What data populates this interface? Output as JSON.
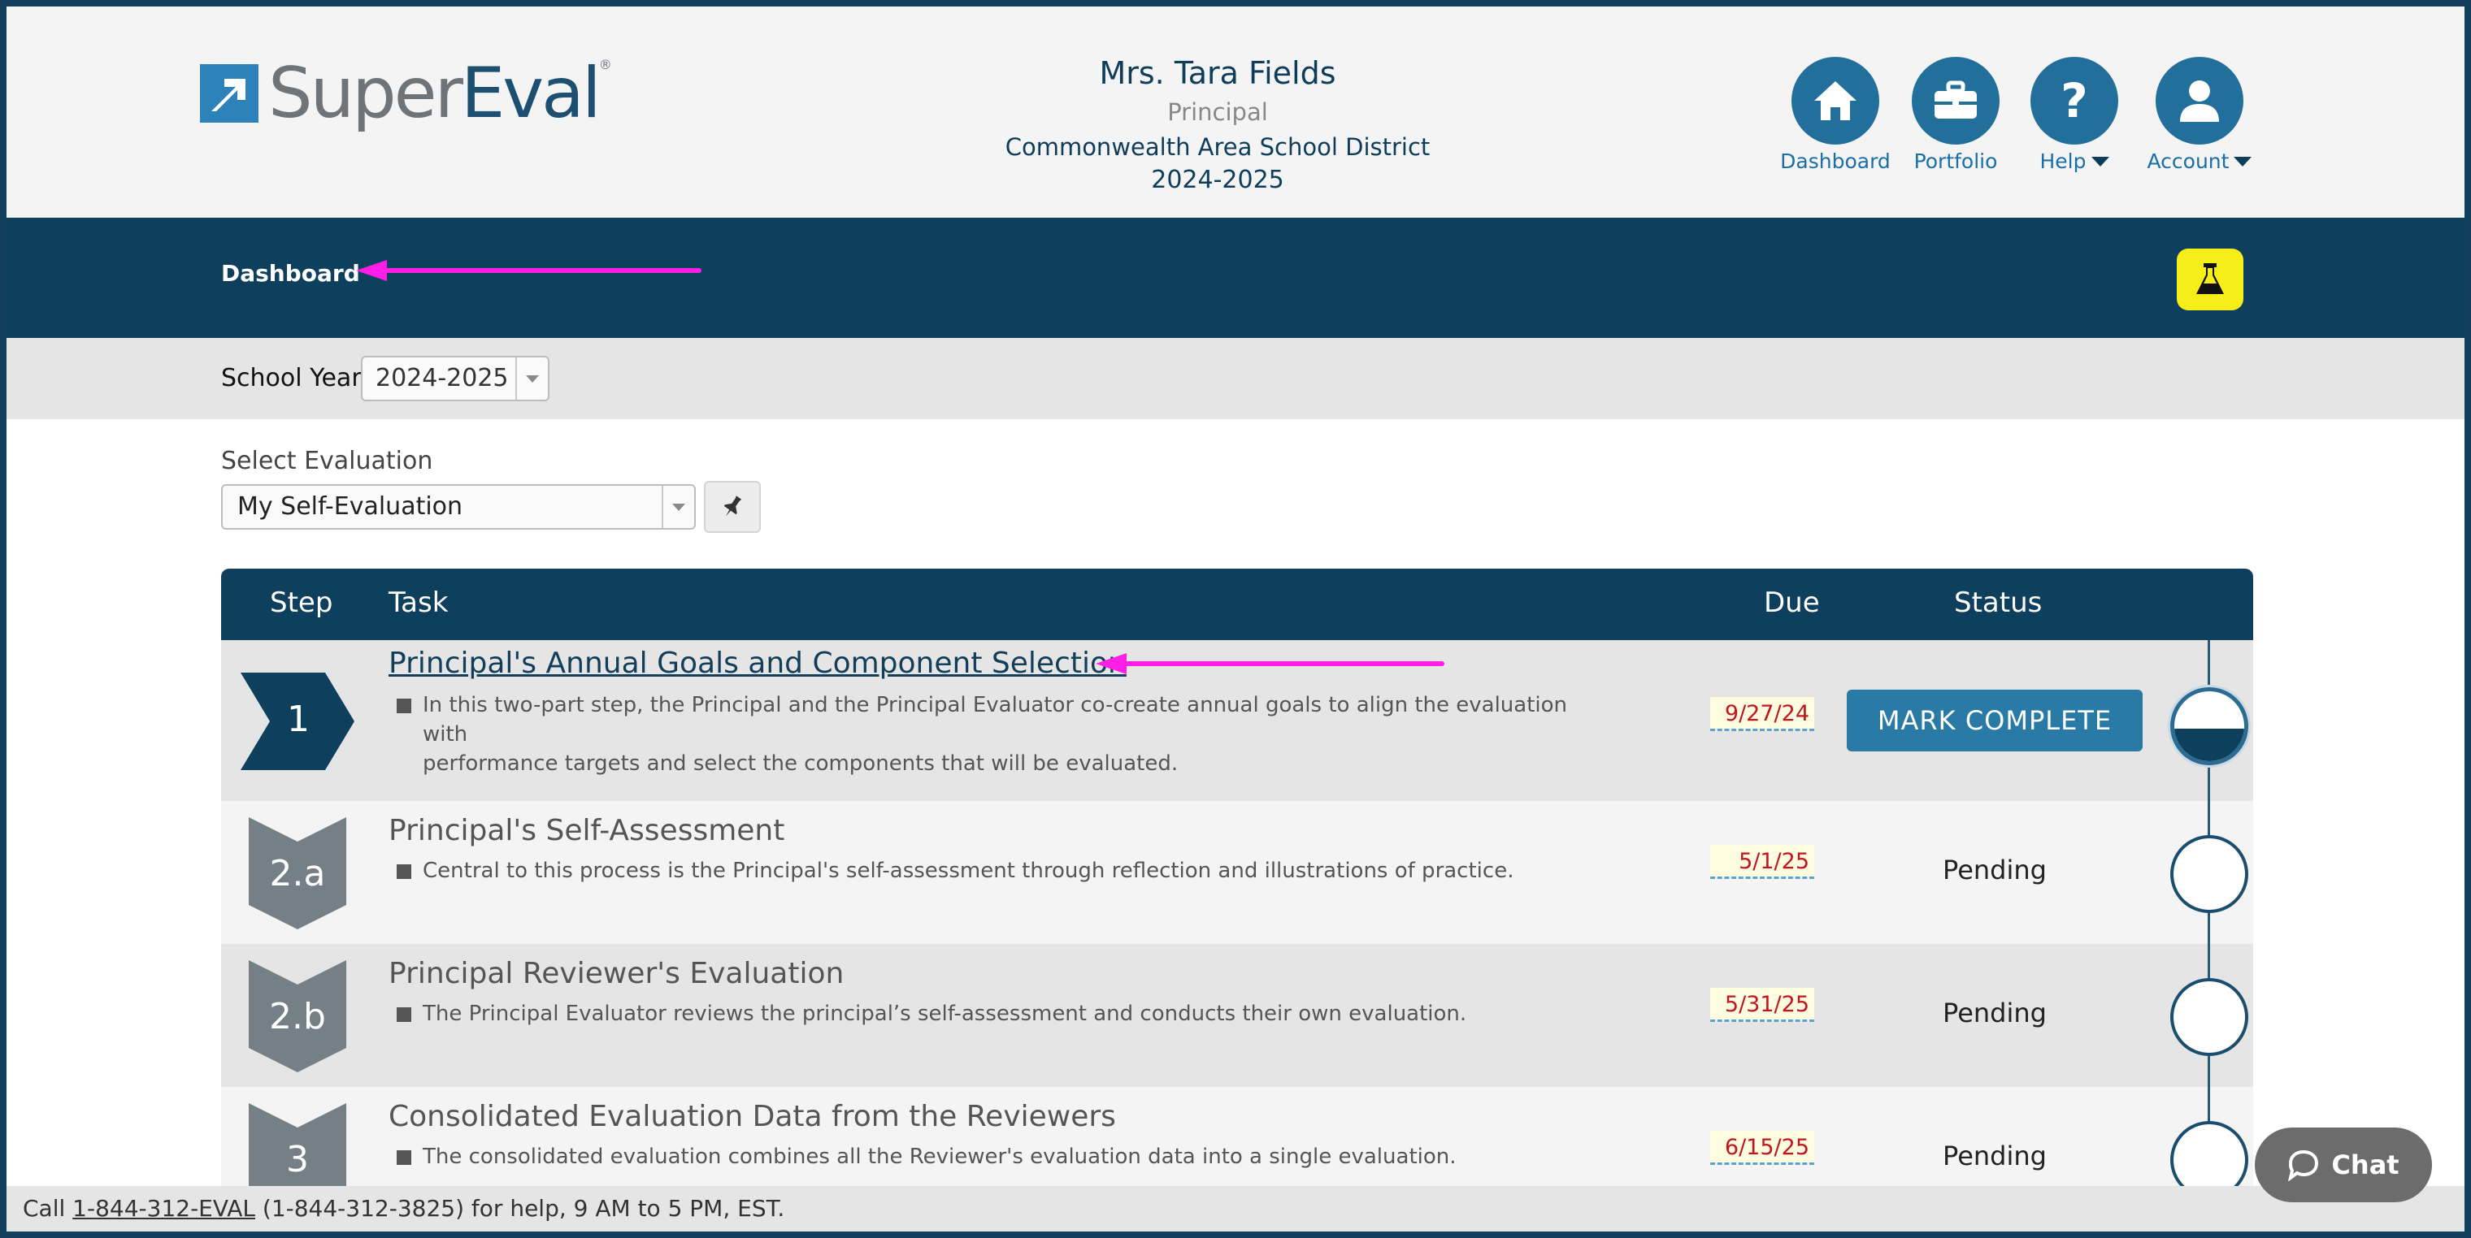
{
  "brand": {
    "logo_super": "Super",
    "logo_eval": "Eval",
    "logo_reg": "®"
  },
  "user": {
    "name": "Mrs. Tara Fields",
    "role": "Principal",
    "district": "Commonwealth Area School District",
    "year": "2024-2025"
  },
  "nav": {
    "dashboard": "Dashboard",
    "portfolio": "Portfolio",
    "help": "Help",
    "account": "Account"
  },
  "breadcrumb": {
    "title": "Dashboard"
  },
  "school_year": {
    "label": "School Year:",
    "value": "2024-2025"
  },
  "evaluation": {
    "label": "Select Evaluation",
    "value": "My Self-Evaluation"
  },
  "table": {
    "headers": {
      "step": "Step",
      "task": "Task",
      "due": "Due",
      "status": "Status"
    },
    "rows": [
      {
        "step": "1",
        "title": "Principal's Annual Goals and Component Selection",
        "desc1": "In this two-part step, the Principal and the Principal Evaluator co-create annual goals to align the evaluation with",
        "desc2": "performance targets and select the components that will be evaluated.",
        "due": "9/27/24",
        "status": "MARK COMPLETE"
      },
      {
        "step": "2.a",
        "title": "Principal's Self-Assessment",
        "desc1": "Central to this process is the Principal's self-assessment through reflection and illustrations of practice.",
        "due": "5/1/25",
        "status": "Pending"
      },
      {
        "step": "2.b",
        "title": "Principal Reviewer's Evaluation",
        "desc1": "The Principal Evaluator reviews the principal’s self-assessment and conducts their own evaluation.",
        "due": "5/31/25",
        "status": "Pending"
      },
      {
        "step": "3",
        "title": "Consolidated Evaluation Data from the Reviewers",
        "desc1": "The consolidated evaluation combines all the Reviewer's evaluation data into a single evaluation.",
        "due": "6/15/25",
        "status": "Pending"
      }
    ]
  },
  "footer": {
    "prefix": "Call ",
    "phone": "1-844-312-EVAL",
    "suffix": " (1-844-312-3825) for help, 9 AM to 5 PM, EST."
  },
  "chat": {
    "label": "Chat"
  },
  "colors": {
    "navy": "#0e3f5c",
    "accent_blue": "#2a7aa6",
    "annotation_magenta": "#ff1ee6",
    "due_red": "#c0171f",
    "flask_yellow": "#f6ee19"
  },
  "icons": [
    "home-icon",
    "briefcase-icon",
    "question-icon",
    "user-icon",
    "flask-icon",
    "pin-icon",
    "chat-bubble-icon"
  ]
}
